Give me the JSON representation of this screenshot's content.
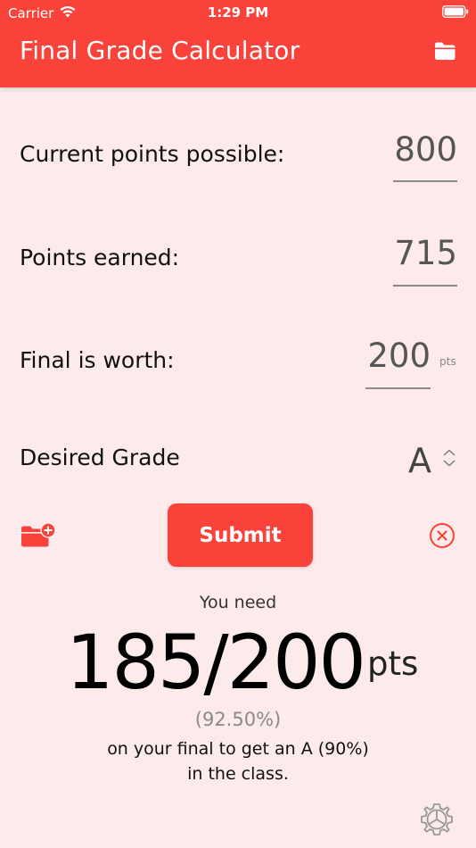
{
  "status_bar": {
    "carrier": "Carrier",
    "time": "1:29 PM"
  },
  "header": {
    "title": "Final Grade Calculator",
    "folder_icon": "folder-icon"
  },
  "form": {
    "current_points_label": "Current points possible:",
    "current_points_value": "800",
    "points_earned_label": "Points earned:",
    "points_earned_value": "715",
    "final_worth_label": "Final is worth:",
    "final_worth_value": "200",
    "final_worth_unit": "pts",
    "desired_grade_label": "Desired Grade",
    "desired_grade_value": "A"
  },
  "actions": {
    "submit_label": "Submit",
    "add_folder_icon": "folder-plus-icon",
    "clear_icon": "close-circle-icon"
  },
  "result": {
    "intro": "You need",
    "score": "185/200",
    "unit": "pts",
    "percent": "(92.50%)",
    "line1": "on your final to get an A (90%)",
    "line2": "in the class."
  },
  "colors": {
    "accent": "#f9433a",
    "background": "#fdeaea"
  }
}
